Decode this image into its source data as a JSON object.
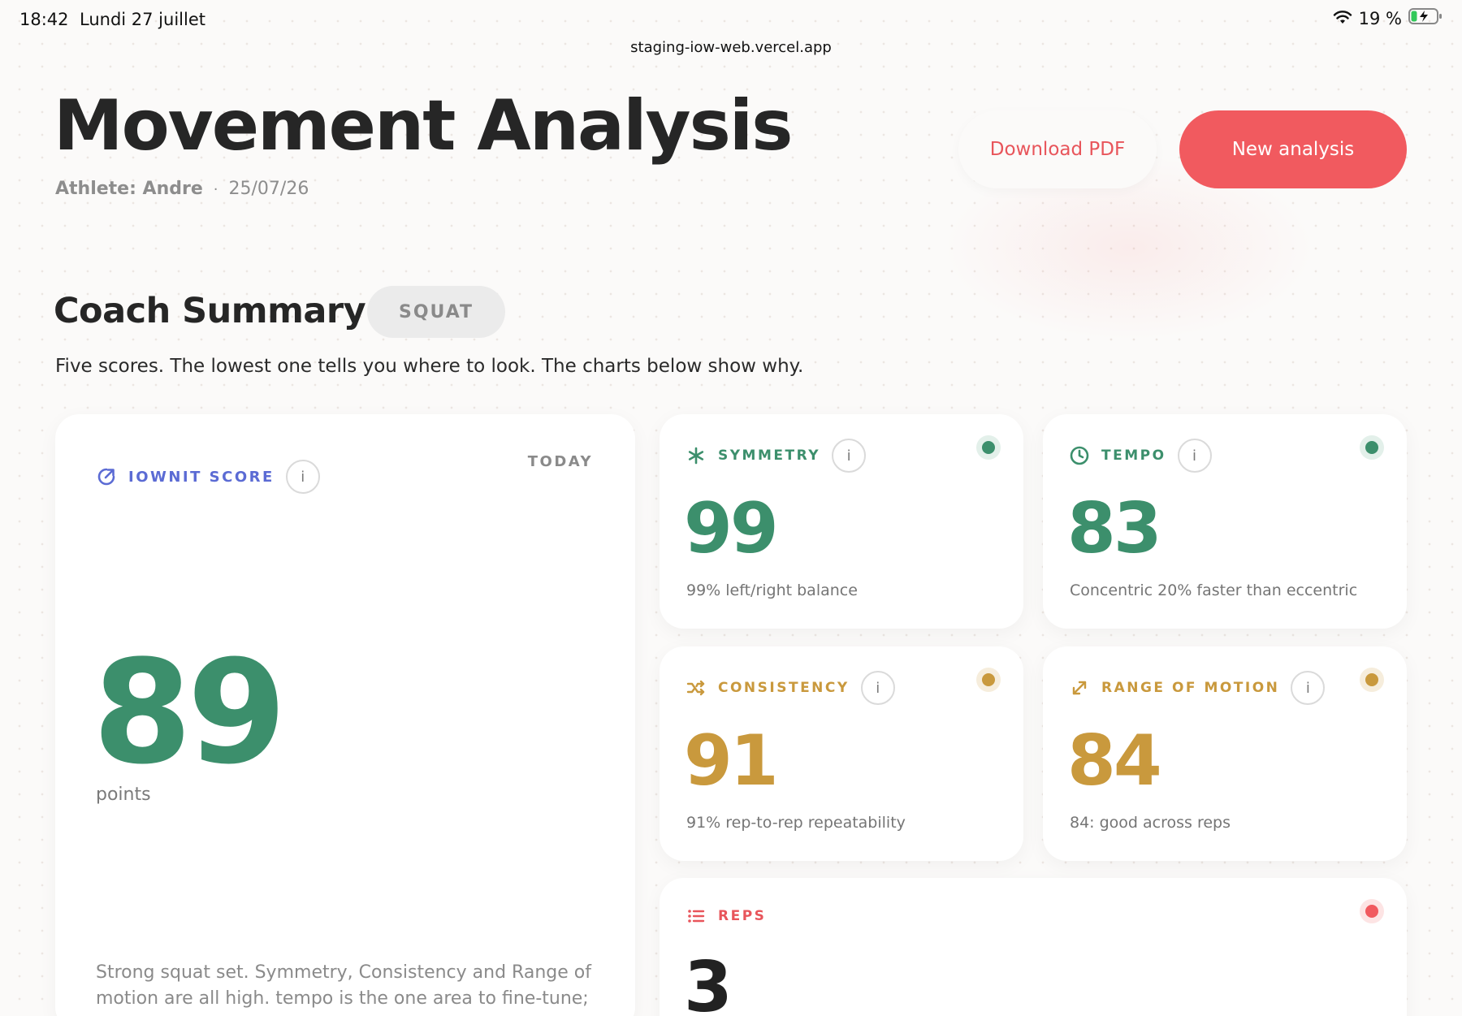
{
  "status_bar": {
    "time": "18:42",
    "date": "Lundi 27 juillet",
    "battery": "19 %"
  },
  "browser": {
    "url": "staging-iow-web.vercel.app"
  },
  "header": {
    "title": "Movement Analysis",
    "athlete": "Athlete: Andre",
    "separator": "·",
    "date": "25/07/26",
    "download_label": "Download PDF",
    "new_label": "New analysis"
  },
  "summary": {
    "title": "Coach Summary",
    "exercise": "SQUAT",
    "description": "Five scores. The lowest one tells you where to look. The charts below show why."
  },
  "main_score": {
    "label": "IOWNIT SCORE",
    "period": "TODAY",
    "value": "89",
    "unit": "points",
    "text": "Strong squat set. Symmetry, Consistency and Range of motion are all high. tempo is the one area to fine-tune; the"
  },
  "metrics": {
    "symmetry": {
      "label": "SYMMETRY",
      "value": "99",
      "desc": "99% left/right balance"
    },
    "tempo": {
      "label": "TEMPO",
      "value": "83",
      "desc": "Concentric 20% faster than eccentric"
    },
    "consistency": {
      "label": "CONSISTENCY",
      "value": "91",
      "desc": "91% rep-to-rep repeatability"
    },
    "rom": {
      "label": "RANGE OF MOTION",
      "value": "84",
      "desc": "84: good across reps"
    },
    "reps": {
      "label": "REPS",
      "value": "3"
    }
  },
  "info_glyph": "i",
  "colors": {
    "good": "#3c8f6c",
    "warning": "#c9993d",
    "alert": "#f15a5f",
    "score_label": "#5b6bd4"
  }
}
